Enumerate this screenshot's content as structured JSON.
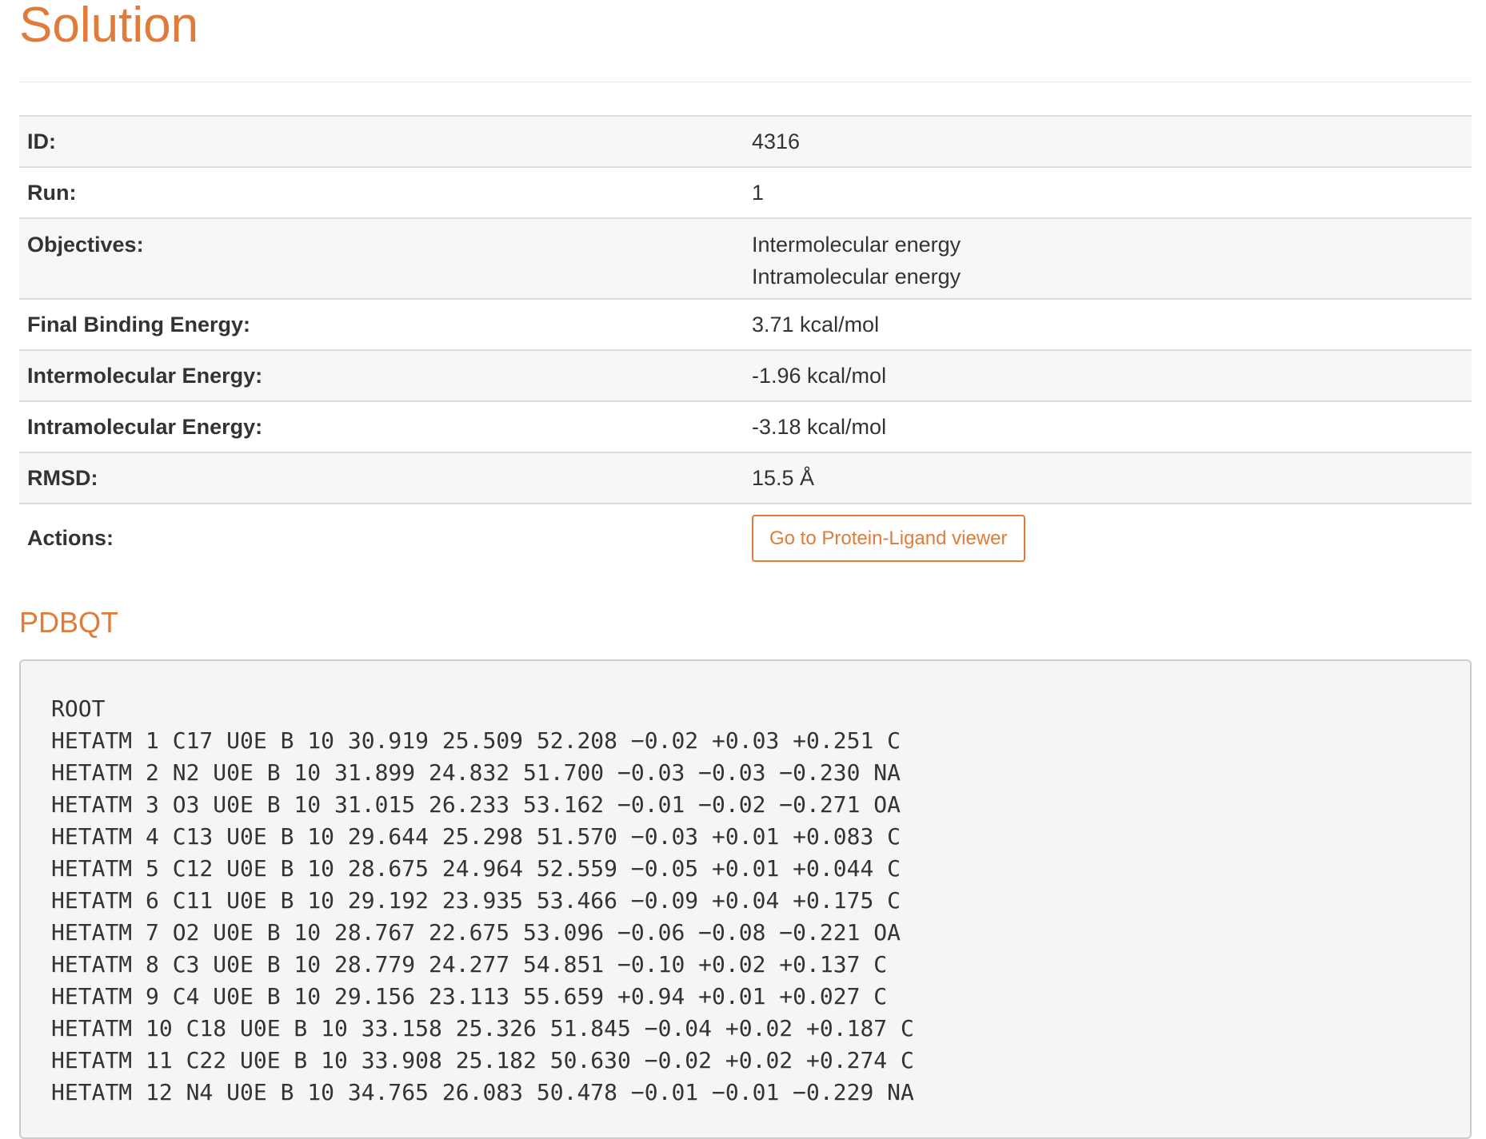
{
  "page": {
    "title": "Solution"
  },
  "details": {
    "id": {
      "label": "ID:",
      "value": "4316"
    },
    "run": {
      "label": "Run:",
      "value": "1"
    },
    "objectives": {
      "label": "Objectives:",
      "values": [
        "Intermolecular energy",
        "Intramolecular energy"
      ]
    },
    "final_binding_energy": {
      "label": "Final Binding Energy:",
      "value": "3.71 kcal/mol"
    },
    "intermolecular_energy": {
      "label": "Intermolecular Energy:",
      "value": "-1.96 kcal/mol"
    },
    "intramolecular_energy": {
      "label": "Intramolecular Energy:",
      "value": "-3.18 kcal/mol"
    },
    "rmsd": {
      "label": "RMSD:",
      "value": "15.5 Å"
    },
    "actions": {
      "label": "Actions:",
      "button_label": "Go to Protein-Ligand viewer"
    }
  },
  "pdbqt": {
    "heading": "PDBQT",
    "lines": [
      "ROOT",
      "HETATM 1 C17 U0E B 10 30.919 25.509 52.208 −0.02 +0.03 +0.251 C",
      "HETATM 2 N2 U0E B 10 31.899 24.832 51.700 −0.03 −0.03 −0.230 NA",
      "HETATM 3 O3 U0E B 10 31.015 26.233 53.162 −0.01 −0.02 −0.271 OA",
      "HETATM 4 C13 U0E B 10 29.644 25.298 51.570 −0.03 +0.01 +0.083 C",
      "HETATM 5 C12 U0E B 10 28.675 24.964 52.559 −0.05 +0.01 +0.044 C",
      "HETATM 6 C11 U0E B 10 29.192 23.935 53.466 −0.09 +0.04 +0.175 C",
      "HETATM 7 O2 U0E B 10 28.767 22.675 53.096 −0.06 −0.08 −0.221 OA",
      "HETATM 8 C3 U0E B 10 28.779 24.277 54.851 −0.10 +0.02 +0.137 C",
      "HETATM 9 C4 U0E B 10 29.156 23.113 55.659 +0.94 +0.01 +0.027 C",
      "HETATM 10 C18 U0E B 10 33.158 25.326 51.845 −0.04 +0.02 +0.187 C",
      "HETATM 11 C22 U0E B 10 33.908 25.182 50.630 −0.02 +0.02 +0.274 C",
      "HETATM 12 N4 U0E B 10 34.765 26.083 50.478 −0.01 −0.01 −0.229 NA"
    ]
  },
  "colors": {
    "accent": "#e07b39",
    "text": "#333333",
    "stripe": "#f7f7f7",
    "code_background": "#f5f5f5"
  }
}
